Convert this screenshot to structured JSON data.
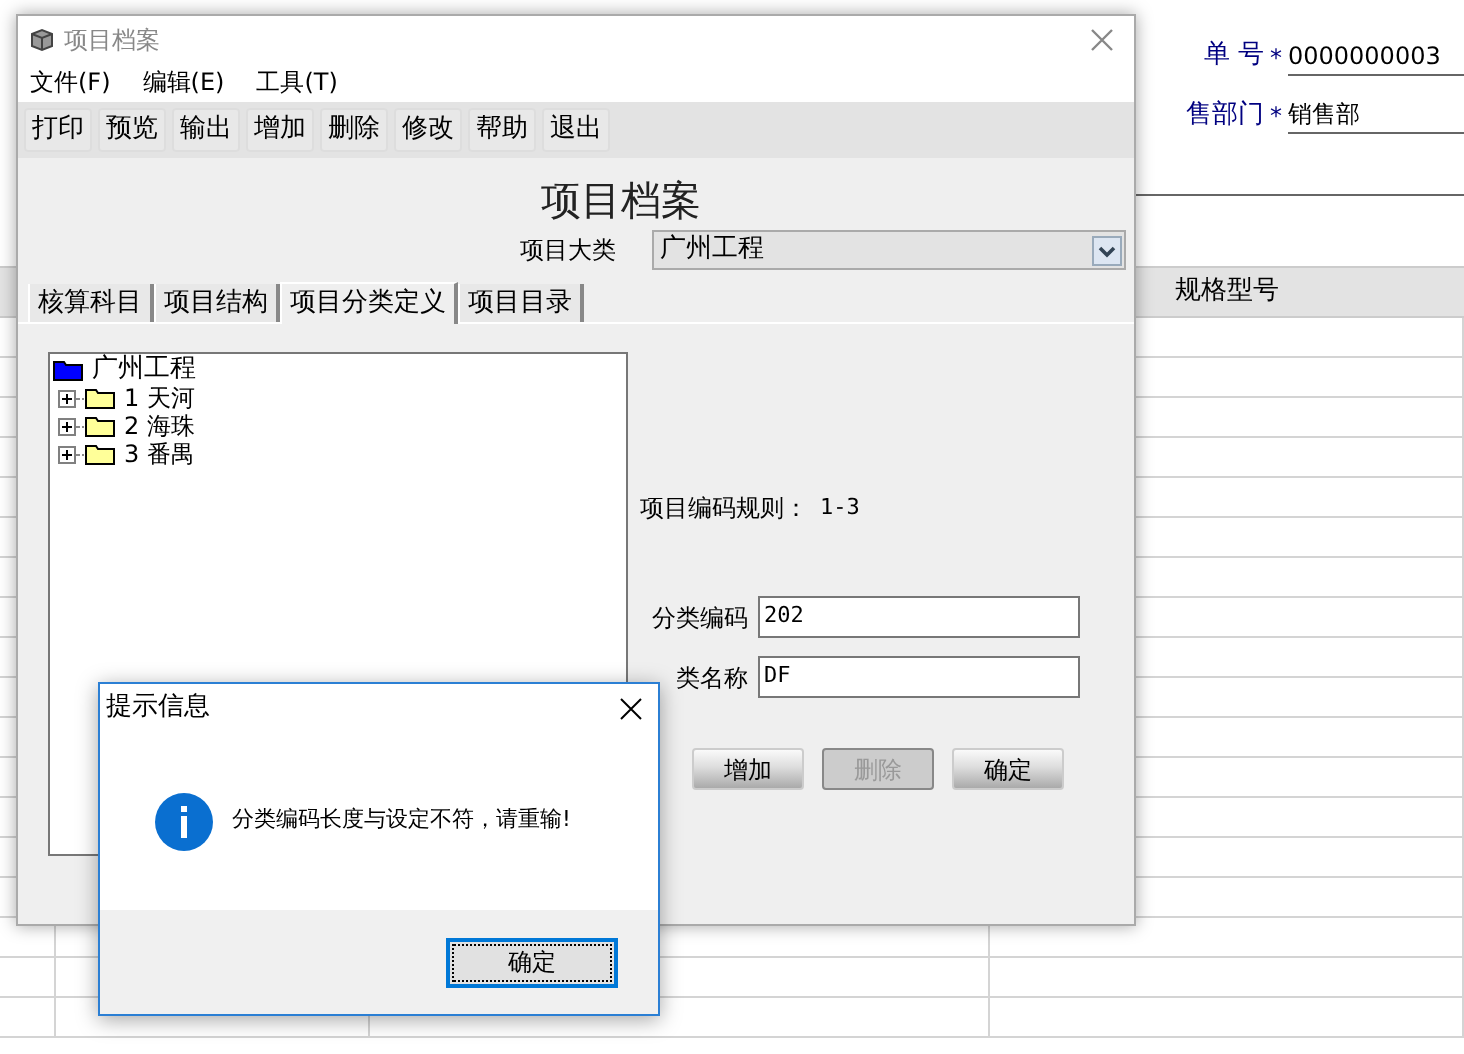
{
  "background": {
    "fields": [
      {
        "label": "单 号",
        "mark": "*",
        "value": "0000000003"
      },
      {
        "label": "售部门",
        "mark": "*",
        "value": "销售部"
      }
    ],
    "table": {
      "columns": [
        "规格型号"
      ]
    }
  },
  "window": {
    "title": "项目档案",
    "menu": [
      "文件(F)",
      "编辑(E)",
      "工具(T)"
    ],
    "toolbar": [
      "打印",
      "预览",
      "输出",
      "增加",
      "删除",
      "修改",
      "帮助",
      "退出"
    ],
    "heading": "项目档案",
    "category": {
      "label": "项目大类",
      "value": "广州工程"
    },
    "tabs": [
      {
        "label": "核算科目",
        "selected": false
      },
      {
        "label": "项目结构",
        "selected": false
      },
      {
        "label": "项目分类定义",
        "selected": true
      },
      {
        "label": "项目目录",
        "selected": false
      }
    ],
    "tree": {
      "label": "广州工程",
      "expanded": true,
      "children": [
        {
          "label": "1 天河",
          "expanded": false
        },
        {
          "label": "2 海珠",
          "expanded": false
        },
        {
          "label": "3 番禺",
          "expanded": false
        }
      ]
    },
    "rule": {
      "label": "项目编码规则：",
      "value": "1-3"
    },
    "fields": [
      {
        "label": "分类编码",
        "value": "202"
      },
      {
        "label": "类名称",
        "value": "DF"
      }
    ],
    "buttons": [
      {
        "label": "增加",
        "disabled": false
      },
      {
        "label": "删除",
        "disabled": true
      },
      {
        "label": "确定",
        "disabled": false
      }
    ]
  },
  "dialog": {
    "title": "提示信息",
    "message": "分类编码长度与设定不符，请重输!",
    "buttons": [
      {
        "label": "确定",
        "focused": true
      }
    ]
  }
}
